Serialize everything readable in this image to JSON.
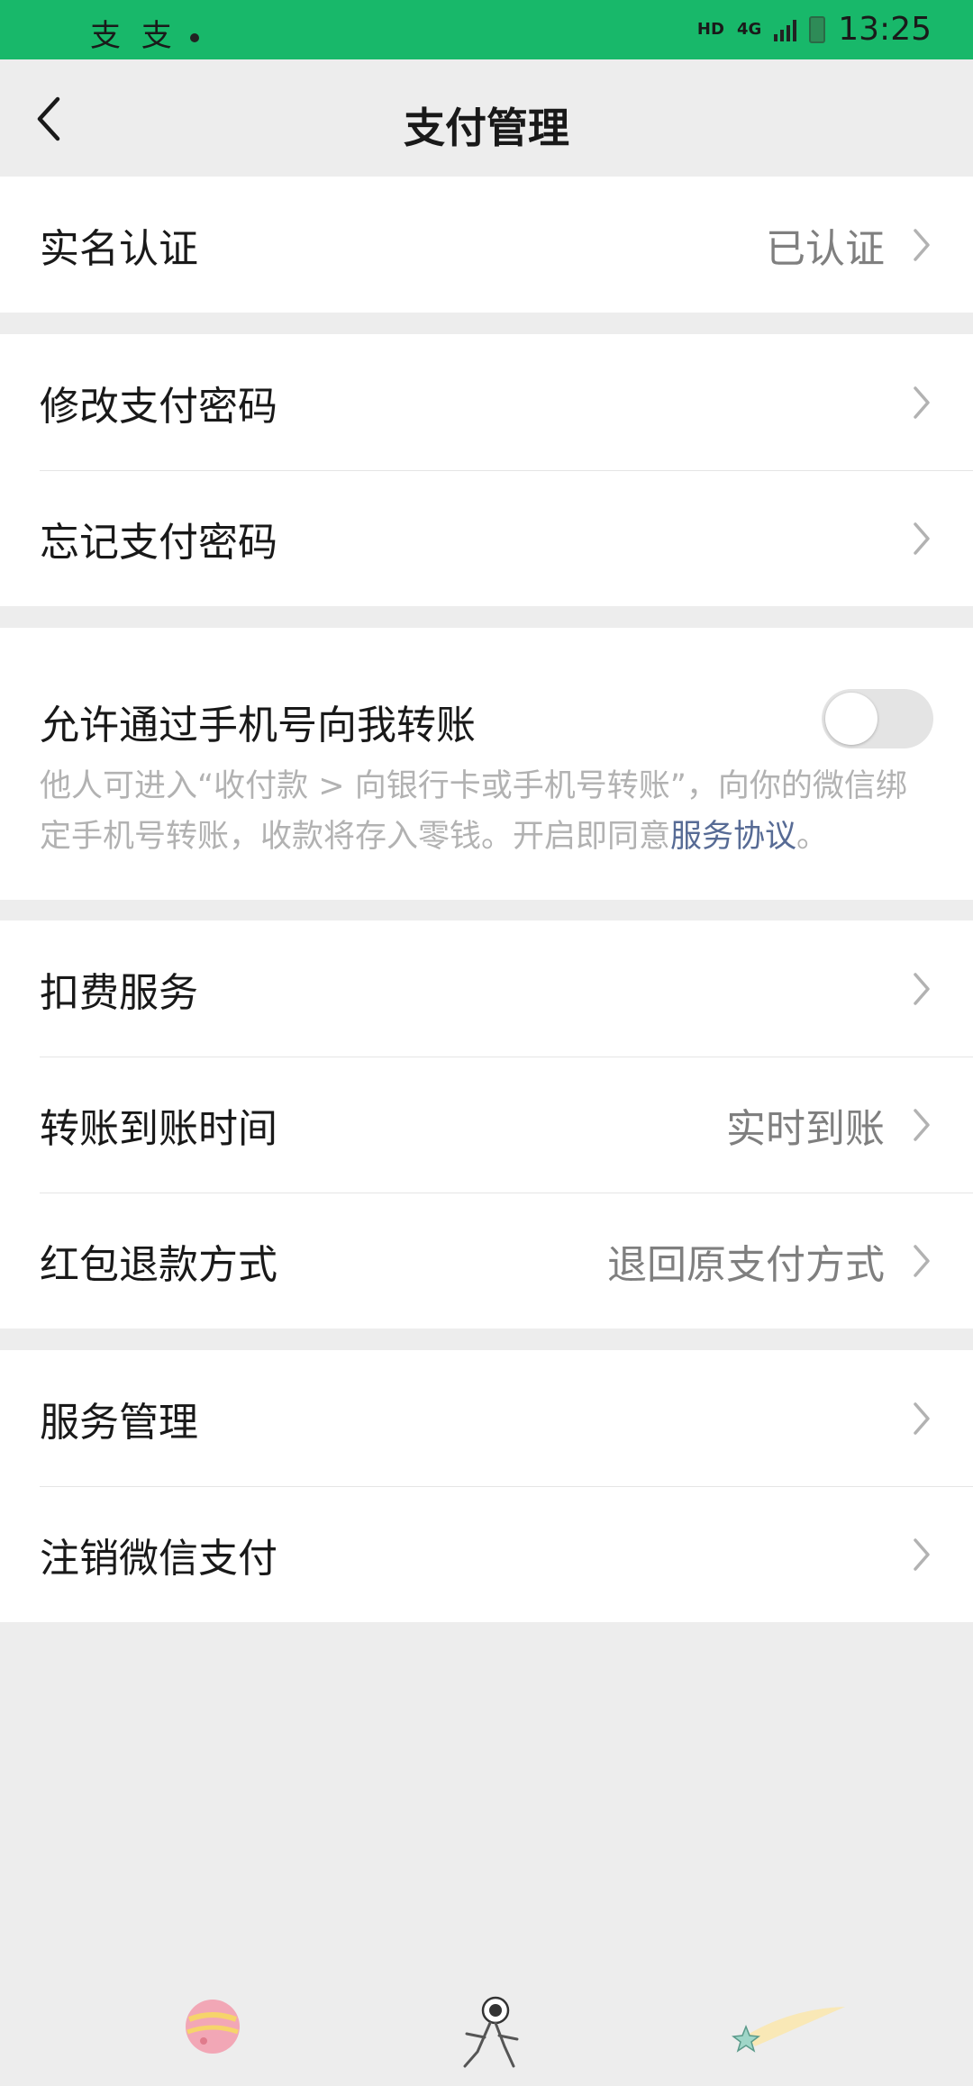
{
  "status_bar": {
    "left_text": "支 支",
    "network_hd": "HD",
    "network_4g": "4G",
    "time": "13:25"
  },
  "nav": {
    "title": "支付管理"
  },
  "groups": {
    "g1": {
      "real_name": {
        "label": "实名认证",
        "value": "已认证"
      }
    },
    "g2": {
      "change_pwd": {
        "label": "修改支付密码"
      },
      "forgot_pwd": {
        "label": "忘记支付密码"
      }
    },
    "g3": {
      "phone_transfer": {
        "label": "允许通过手机号向我转账",
        "enabled": false,
        "desc_prefix": "他人可进入“收付款 > 向银行卡或手机号转账”，向你的微信绑定手机号转账，收款将存入零钱。开启即同意",
        "desc_link": "服务协议",
        "desc_suffix": "。"
      }
    },
    "g4": {
      "deduct_service": {
        "label": "扣费服务"
      },
      "transfer_time": {
        "label": "转账到账时间",
        "value": "实时到账"
      },
      "red_packet_refund": {
        "label": "红包退款方式",
        "value": "退回原支付方式"
      }
    },
    "g5": {
      "service_mgmt": {
        "label": "服务管理"
      },
      "deactivate_pay": {
        "label": "注销微信支付"
      }
    }
  },
  "colors": {
    "status_bar": "#18b86a",
    "link": "#576b95",
    "background": "#ededed"
  }
}
